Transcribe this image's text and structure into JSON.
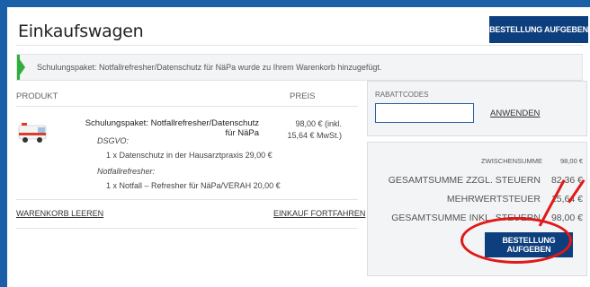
{
  "header": {
    "title": "Einkaufswagen",
    "checkout_label": "BESTELLUNG AUFGEBEN"
  },
  "notice": {
    "text": "Schulungspaket: Notfallrefresher/Datenschutz für NäPa wurde zu Ihrem Warenkorb hinzugefügt."
  },
  "cart": {
    "columns": {
      "product": "PRODUKT",
      "price": "PREIS"
    },
    "item": {
      "image_icon": "ambulance-icon",
      "name": "Schulungspaket: Notfallrefresher/Datenschutz für NäPa",
      "options": [
        {
          "label": "DSGVO:",
          "value": "1 x Datenschutz in der Hausarztpraxis 29,00 €"
        },
        {
          "label": "Notfallrefresher:",
          "value": "1 x Notfall – Refresher für NäPa/VERAH 20,00 €"
        }
      ],
      "price_line1": "98,00 € (inkl.",
      "price_line2": "15,64 € MwSt.)"
    },
    "clear_label": "WARENKORB LEEREN",
    "continue_label": "EINKAUF FORTFAHREN"
  },
  "coupon": {
    "label": "RABATTCODES",
    "input_value": "",
    "apply_label": "ANWENDEN"
  },
  "totals": {
    "subtotal_label": "ZWISCHENSUMME",
    "subtotal_value": "98,00 €",
    "total_excl_label": "GESAMTSUMME ZZGL. STEUERN",
    "total_excl_value": "82,36 €",
    "tax_label": "MEHRWERTSTEUER",
    "tax_value": "15,64 €",
    "total_incl_label": "GESAMTSUMME INKL. STEUERN",
    "total_incl_value": "98,00 €",
    "checkout_label": "BESTELLUNG AUFGEBEN"
  },
  "colors": {
    "brand": "#0d3e7e",
    "success": "#2eae3a",
    "annotation": "#e01818",
    "background": "#1a5fa8"
  }
}
